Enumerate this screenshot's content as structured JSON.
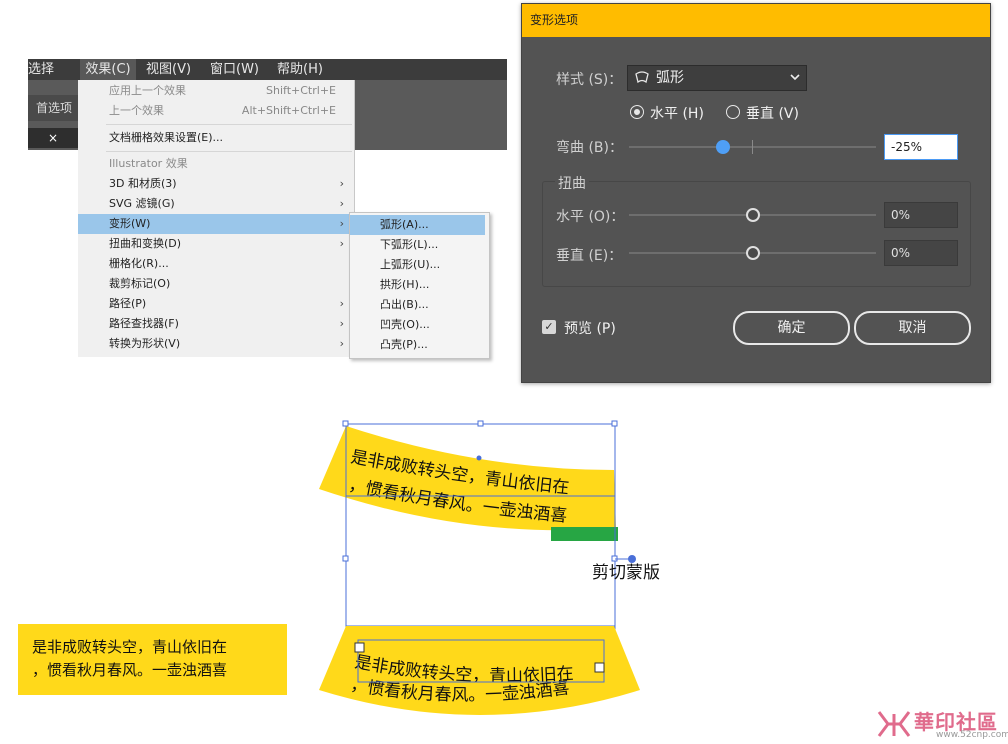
{
  "menubar": {
    "items": [
      "选择(S)",
      "效果(C)",
      "视图(V)",
      "窗口(W)",
      "帮助(H)"
    ],
    "active_index": 1
  },
  "toolbar": {
    "prefs_tab": "首选项",
    "close_glyph": "×"
  },
  "effect_menu": {
    "items": [
      {
        "label": "应用上一个效果",
        "shortcut": "Shift+Ctrl+E",
        "disabled": true
      },
      {
        "label": "上一个效果",
        "shortcut": "Alt+Shift+Ctrl+E",
        "disabled": true
      },
      {
        "label": "文档栅格效果设置(E)..."
      },
      {
        "label": "Illustrator 效果",
        "disabled": true
      },
      {
        "label": "3D 和材质(3)",
        "submenu": true
      },
      {
        "label": "SVG 滤镜(G)",
        "submenu": true
      },
      {
        "label": "变形(W)",
        "submenu": true,
        "highlighted": true
      },
      {
        "label": "扭曲和变换(D)",
        "submenu": true
      },
      {
        "label": "栅格化(R)..."
      },
      {
        "label": "裁剪标记(O)"
      },
      {
        "label": "路径(P)",
        "submenu": true
      },
      {
        "label": "路径查找器(F)",
        "submenu": true
      },
      {
        "label": "转换为形状(V)",
        "submenu": true
      }
    ]
  },
  "warp_submenu": {
    "items": [
      "弧形(A)...",
      "下弧形(L)...",
      "上弧形(U)...",
      "拱形(H)...",
      "凸出(B)...",
      "凹壳(O)...",
      "凸壳(P)..."
    ],
    "highlighted_index": 0
  },
  "dialog": {
    "title": "变形选项",
    "style_label": "样式 (S)：",
    "style_value": "弧形",
    "style_icon": "arc-warp-icon",
    "horizontal_label": "水平 (H)",
    "vertical_label": "垂直 (V)",
    "orientation": "horizontal",
    "bend_label": "弯曲 (B)：",
    "bend_value": "-25%",
    "bend_level": -25,
    "distort_group": "扭曲",
    "distort_h_label": "水平 (O)：",
    "distort_h_value": "0%",
    "distort_v_label": "垂直 (E)：",
    "distort_v_value": "0%",
    "preview_label": "预览 (P)",
    "preview_checked": true,
    "ok_label": "确定",
    "cancel_label": "取消",
    "accent": "#ffbc00"
  },
  "artwork": {
    "text_line1": "是非成败转头空，青山依旧在",
    "text_line2": "，惯看秋月春风。一壶浊酒喜",
    "clip_label": "剪切蒙版",
    "flat_line1": "是非成败转头空，青山依旧在",
    "flat_line2": "，惯看秋月春风。一壶浊酒喜",
    "yellow": "#ffd91a",
    "green": "#27a644"
  },
  "watermark": {
    "chinese": "華印社區",
    "url": "www.52cnp.com"
  }
}
